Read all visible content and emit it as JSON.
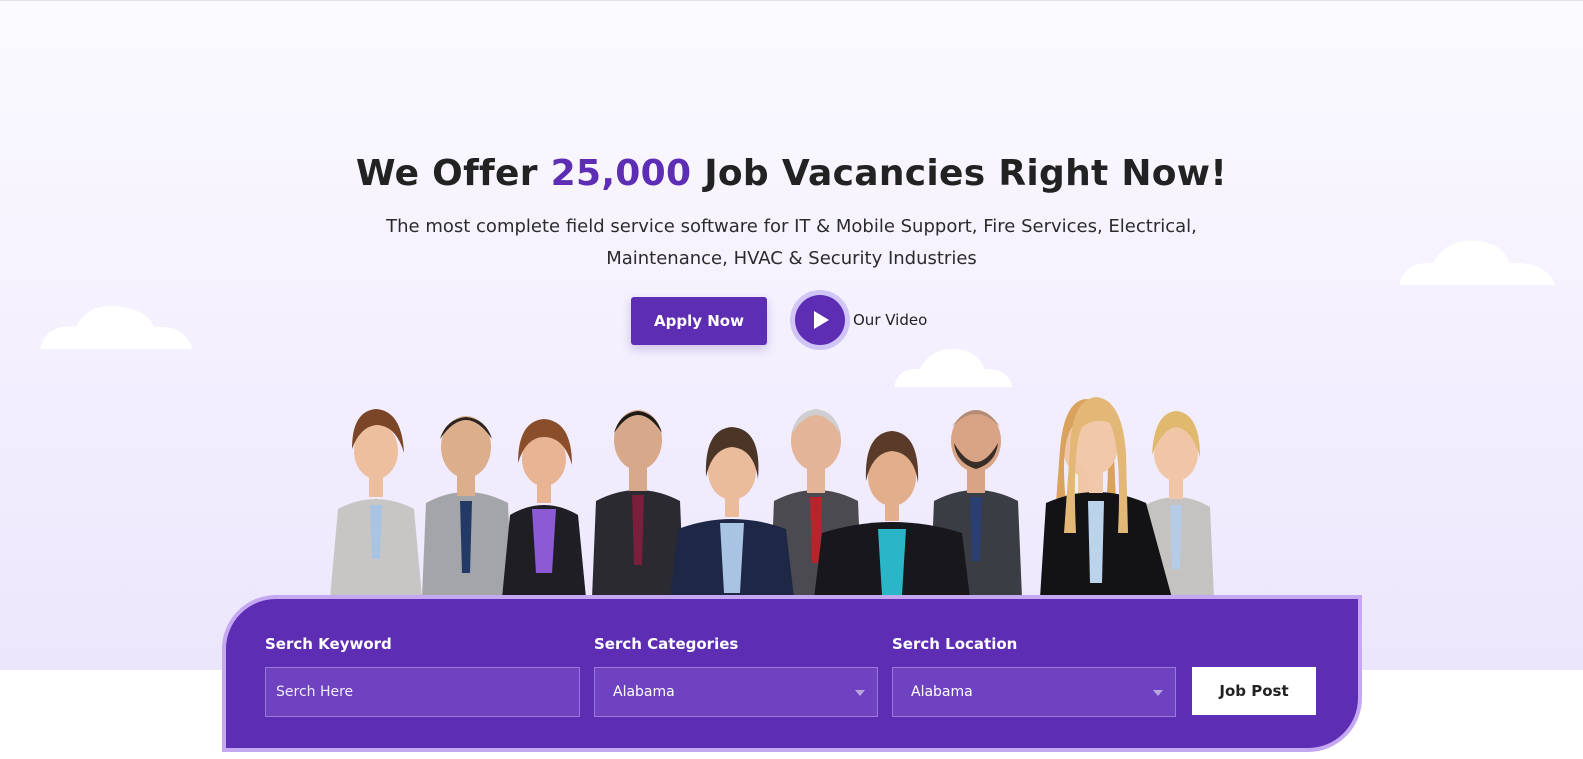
{
  "hero": {
    "headline_prefix": "We Offer",
    "headline_count": "25,000",
    "headline_suffix": "Job Vacancies Right Now!",
    "subtitle_line1": "The most complete field service software for IT & Mobile Support, Fire Services, Electrical,",
    "subtitle_line2": "Maintenance, HVAC & Security Industries",
    "apply_label": "Apply Now",
    "video_label": "Our Video",
    "accent_color": "#5d2db4"
  },
  "search": {
    "keyword_label": "Serch Keyword",
    "keyword_placeholder": "Serch Here",
    "category_label": "Serch Categories",
    "category_value": "Alabama",
    "location_label": "Serch Location",
    "location_value": "Alabama",
    "submit_label": "Job Post",
    "panel_color": "#5d2db4",
    "border_color": "#c4a8f2"
  },
  "icons": [
    "play-icon",
    "chevron-down-icon",
    "cloud-icon"
  ]
}
